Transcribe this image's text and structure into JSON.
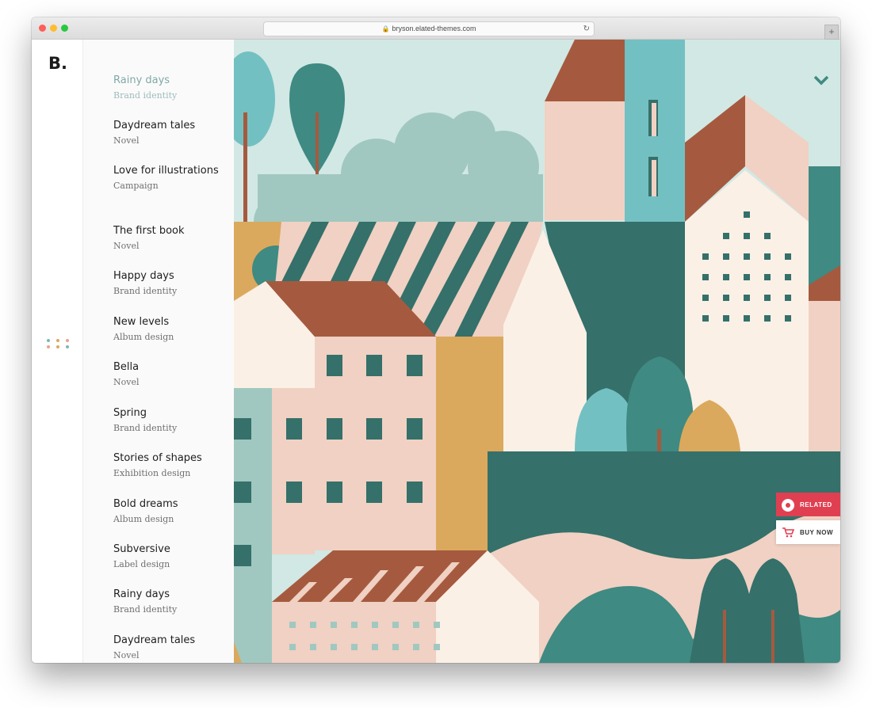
{
  "browser": {
    "url": "bryson.elated-themes.com",
    "reload_icon": "reload-icon",
    "new_tab_icon": "plus-icon"
  },
  "site": {
    "logo": "B.",
    "menu_icon": "dots-grid-icon"
  },
  "menu": {
    "items": [
      {
        "title": "Rainy days",
        "subtitle": "Brand identity",
        "active": true
      },
      {
        "title": "Daydream tales",
        "subtitle": "Novel"
      },
      {
        "title": "Love for illustrations",
        "subtitle": "Campaign"
      },
      {
        "title": "The first book",
        "subtitle": "Novel"
      },
      {
        "title": "Happy days",
        "subtitle": "Brand identity"
      },
      {
        "title": "New levels",
        "subtitle": "Album design"
      },
      {
        "title": "Bella",
        "subtitle": "Novel"
      },
      {
        "title": "Spring",
        "subtitle": "Brand identity"
      },
      {
        "title": "Stories of shapes",
        "subtitle": "Exhibition design"
      },
      {
        "title": "Bold dreams",
        "subtitle": "Album design"
      },
      {
        "title": "Subversive",
        "subtitle": "Label design"
      },
      {
        "title": "Rainy days",
        "subtitle": "Brand identity"
      },
      {
        "title": "Daydream tales",
        "subtitle": "Novel"
      }
    ]
  },
  "floating": {
    "related_label": "RELATED",
    "buy_now_label": "BUY NOW",
    "scroll_icon": "chevron-down-icon"
  },
  "colors": {
    "accent": "#e03f52",
    "teal_dark": "#35706a",
    "teal_mid": "#3f8a82",
    "teal_light": "#73c0c2",
    "sage": "#a0c8c0",
    "sky": "#d2e8e4",
    "rust": "#a55a3f",
    "peach": "#f0d1c3",
    "cream": "#fbf0e6",
    "mustard": "#dba95d"
  }
}
